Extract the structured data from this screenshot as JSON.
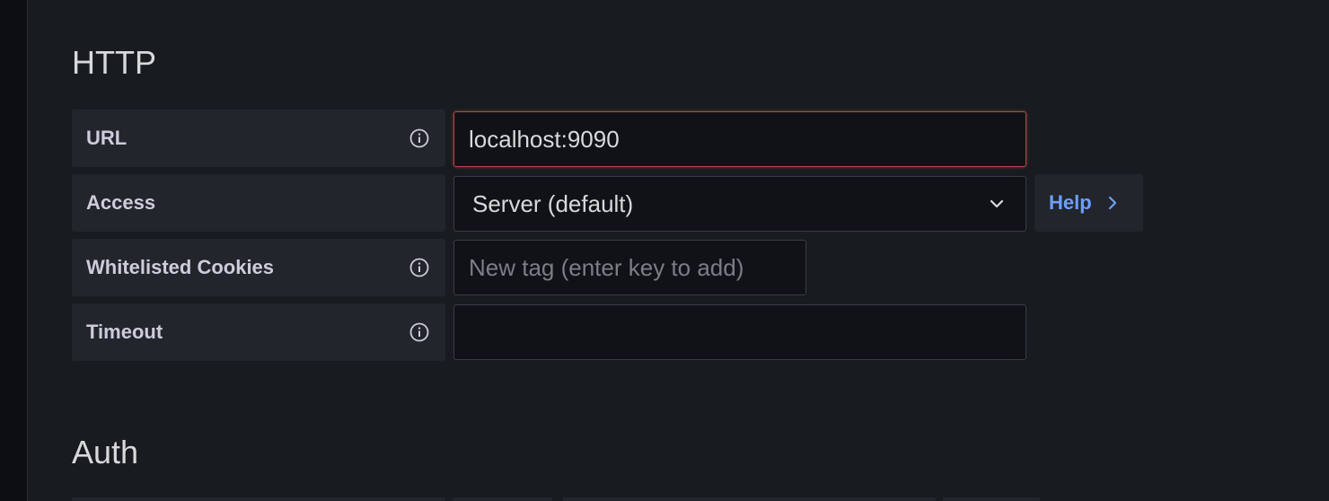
{
  "http_section": {
    "title": "HTTP",
    "rows": {
      "url": {
        "label": "URL",
        "value": "localhost:9090",
        "icon": "info-icon"
      },
      "access": {
        "label": "Access",
        "selected": "Server (default)",
        "help_label": "Help"
      },
      "cookies": {
        "label": "Whitelisted Cookies",
        "placeholder": "New tag (enter key to add)",
        "icon": "info-icon"
      },
      "timeout": {
        "label": "Timeout",
        "value": "",
        "icon": "info-icon"
      }
    }
  },
  "auth_section": {
    "title": "Auth"
  },
  "colors": {
    "background": "#181b1f",
    "label_bg": "#22252b",
    "input_bg": "#111217",
    "error_border": "#b94a46",
    "link": "#6e9fff"
  }
}
